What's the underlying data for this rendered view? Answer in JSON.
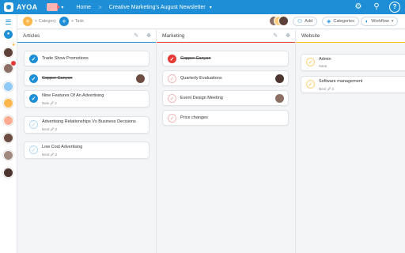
{
  "app": {
    "name": "AYOA"
  },
  "topbar": {
    "home": "Home",
    "separator": ">",
    "board_title": "Creative Marketing's August Newsletter",
    "board_caret": "▾",
    "workspace_caret": "▾",
    "icons": [
      "settings-icon",
      "search-icon",
      "help-icon"
    ],
    "help_glyph": "?"
  },
  "subbar": {
    "add_category": "+ Category",
    "add_task": "+ Task",
    "add_label": "Add",
    "categories_label": "Categories",
    "workflow_label": "Workflow",
    "workflow_caret": "▾"
  },
  "rail": {
    "icons": [
      "home-icon",
      "chat-icon"
    ],
    "badge_count": "3"
  },
  "columns": [
    {
      "title": "Articles",
      "color": "#1e8fd6",
      "cards": [
        {
          "title": "Trade Show Promotions",
          "check": "filled-blue",
          "done": false,
          "sub": ""
        },
        {
          "title": "Copper Canyon",
          "check": "filled-blue",
          "done": true,
          "sub": "",
          "avatar": true
        },
        {
          "title": "Nine Features Of An Advertising",
          "check": "filled-blue",
          "done": false,
          "sub": "New  🖉 2"
        },
        {
          "title": "Advertising Relationships Vs Business Decisions",
          "check": "ring-blue",
          "done": false,
          "sub": "Next  🖉 2"
        },
        {
          "title": "Low Cost Advertising",
          "check": "ring-blue",
          "done": false,
          "sub": "Next  🖉 2"
        }
      ]
    },
    {
      "title": "Marketing",
      "color": "#e53935",
      "cards": [
        {
          "title": "Copper Canyon",
          "check": "filled-red",
          "done": true,
          "sub": ""
        },
        {
          "title": "Quarterly Evaluations",
          "check": "ring-red",
          "done": false,
          "sub": "",
          "avatar": true
        },
        {
          "title": "Event Design Meeting",
          "check": "ring-red",
          "done": false,
          "sub": "",
          "avatar": true
        },
        {
          "title": "Price changes",
          "check": "ring-red",
          "done": false,
          "sub": ""
        }
      ]
    },
    {
      "title": "Website",
      "color": "#ffc107",
      "cards": [
        {
          "title": "Admin",
          "check": "ring-yellow",
          "done": false,
          "sub": "Save"
        },
        {
          "title": "Software management",
          "check": "ring-yellow",
          "done": false,
          "sub": "Next  🖉 2"
        }
      ]
    }
  ],
  "check_glyph": "✓"
}
